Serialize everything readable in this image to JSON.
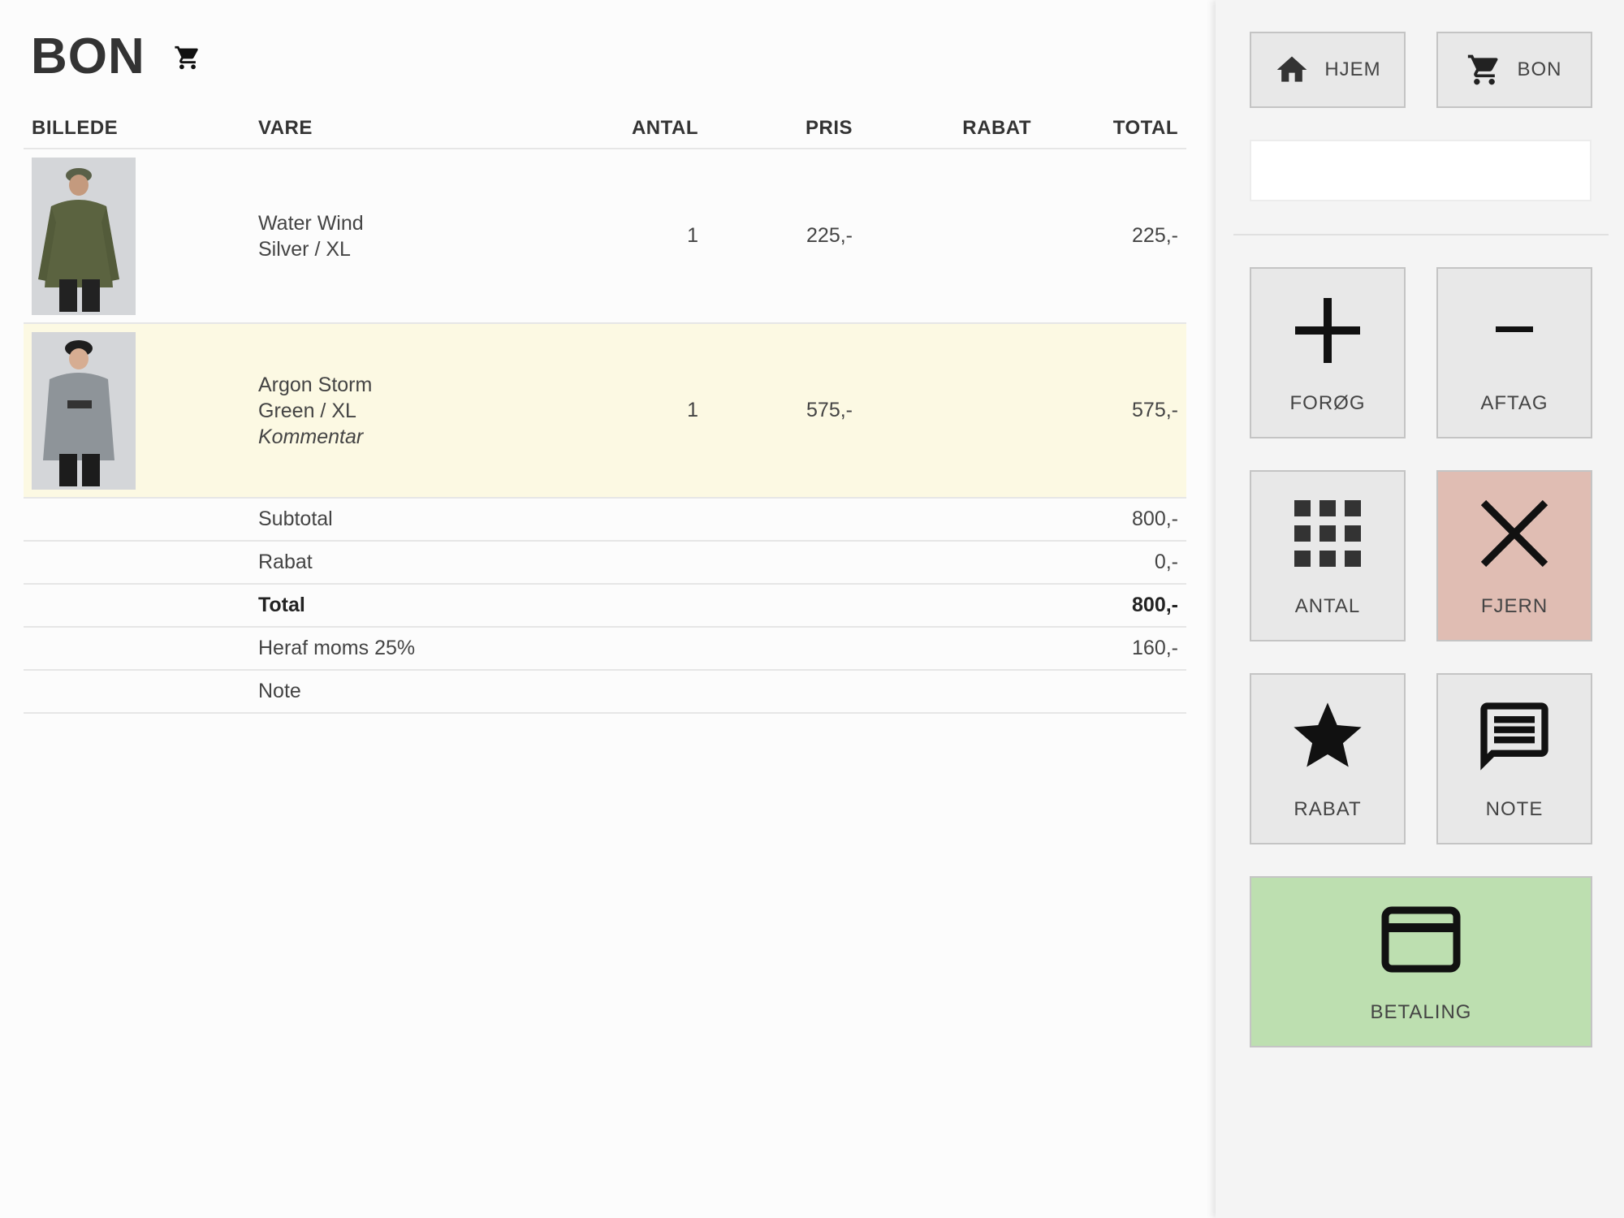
{
  "header": {
    "title": "BON",
    "cart_icon": "cart-icon"
  },
  "table": {
    "columns": [
      "BILLEDE",
      "VARE",
      "ANTAL",
      "PRIS",
      "RABAT",
      "TOTAL"
    ],
    "rows": [
      {
        "name_line": "Water Wind",
        "variant_line": "Silver / XL",
        "comment": "",
        "antal": "1",
        "pris": "225,-",
        "rabat": "",
        "total": "225,-",
        "selected": false
      },
      {
        "name_line": "Argon Storm",
        "variant_line": "Green / XL",
        "comment": "Kommentar",
        "antal": "1",
        "pris": "575,-",
        "rabat": "",
        "total": "575,-",
        "selected": true
      }
    ],
    "summary": [
      {
        "label": "Subtotal",
        "value": "800,-"
      },
      {
        "label": "Rabat",
        "value": "0,-"
      },
      {
        "label": "Total",
        "value": "800,-"
      },
      {
        "label": "Heraf moms 25%",
        "value": "160,-"
      },
      {
        "label": "Note",
        "value": ""
      }
    ]
  },
  "sidebar": {
    "home_label": "HJEM",
    "bon_label": "BON",
    "search_value": "",
    "search_placeholder": "",
    "actions": {
      "increase": "FORØG",
      "decrease": "AFTAG",
      "quantity": "ANTAL",
      "remove": "FJERN",
      "discount": "RABAT",
      "note": "NOTE",
      "payment": "BETALING"
    }
  },
  "colors": {
    "selected_row": "#fcf9e3",
    "remove_button": "#e0bdb3",
    "payment_button": "#bddfb0",
    "button_bg": "#e8e8e8"
  }
}
